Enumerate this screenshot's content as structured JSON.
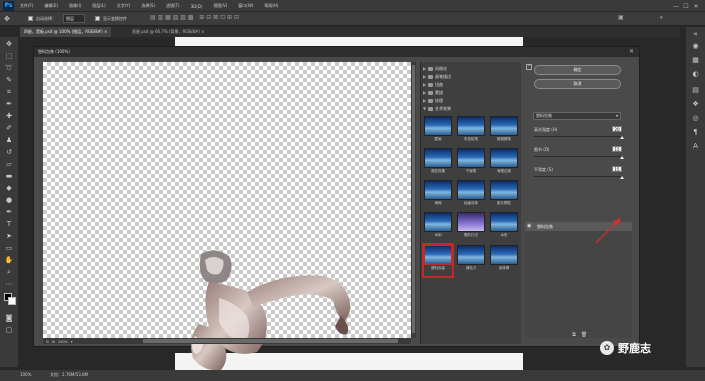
{
  "app": {
    "logo": "Ps"
  },
  "menubar": {
    "items": [
      "文件(F)",
      "编辑(E)",
      "图像(I)",
      "图层(L)",
      "文字(Y)",
      "选择(S)",
      "滤镜(T)",
      "3D(D)",
      "视图(V)",
      "窗口(W)",
      "帮助(H)"
    ],
    "window_controls": [
      "—",
      "☐",
      "✕"
    ]
  },
  "options": {
    "auto_select_label": "自动选择：",
    "auto_select_value": "图层",
    "show_transform_label": "显示变换控件"
  },
  "tabs": [
    {
      "label": "四星，黑板.psd @ 100% (图层，RGB/8#) ×",
      "active": true
    },
    {
      "label": "恶星.psd @ 66.7% (背景，RGB/8#) ×",
      "active": false
    }
  ],
  "dialog": {
    "title": "塑料包装 (100%)",
    "close": "✕"
  },
  "preview": {
    "zoom": "100%"
  },
  "gallery": {
    "folders": [
      "风格化",
      "画笔描边",
      "扭曲",
      "素描",
      "纹理"
    ],
    "open_folder": "艺术效果",
    "filters": [
      "壁画",
      "彩色铅笔",
      "粗糙蜡笔",
      "底纹效果",
      "干画笔",
      "海报边缘",
      "海绵",
      "绘画涂抹",
      "胶片颗粒",
      "木刻",
      "霓虹灯光",
      "水彩",
      "塑料包装",
      "调色刀",
      "涂抹棒"
    ],
    "selected_filter": "塑料包装"
  },
  "settings": {
    "ok_label": "确定",
    "cancel_label": "取消",
    "filter_name": "塑料包装",
    "params": [
      {
        "label": "高光强度 (H)",
        "value": "20",
        "fraction": 1.0
      },
      {
        "label": "细节 (D)",
        "value": "15",
        "fraction": 1.0
      },
      {
        "label": "平滑度 (S)",
        "value": "15",
        "fraction": 1.0
      }
    ]
  },
  "layer_panel": {
    "layer_name": "塑料包装"
  },
  "statusbar": {
    "zoom": "100%",
    "doc": "文档：2.76M/53.8M"
  },
  "watermark": {
    "text": "野鹿志"
  },
  "colors": {
    "selection_red": "#c62828",
    "annotation_arrow": "#d32f2f"
  }
}
